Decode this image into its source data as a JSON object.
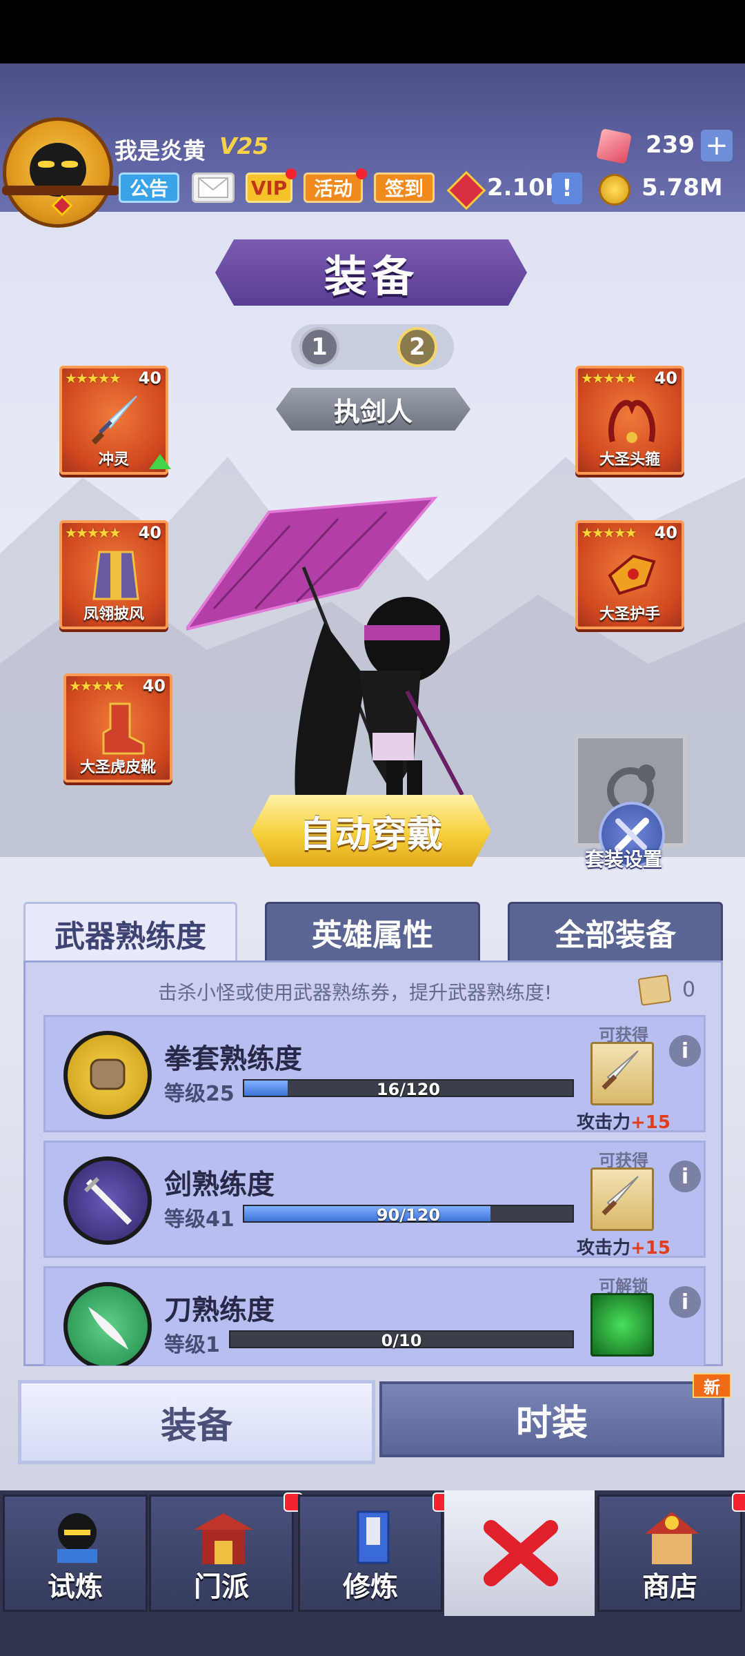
{
  "player": {
    "name": "我是炎黄",
    "vip_level": "V25"
  },
  "top_buttons": {
    "notice": "公告",
    "vip": "VIP",
    "activity": "活动",
    "signin": "签到"
  },
  "resources": {
    "gems": "239",
    "honor": "2.10K",
    "coins": "5.78M"
  },
  "screen_title": "装备",
  "page_switch": {
    "page1": "1",
    "page2": "2",
    "selected": "2"
  },
  "class_name": "执剑人",
  "equipment": [
    {
      "name": "冲灵",
      "level": "40",
      "stars": "★★★★★",
      "upgrade": true
    },
    {
      "name": "凤翎披风",
      "level": "40",
      "stars": "★★★★★"
    },
    {
      "name": "大圣虎皮靴",
      "level": "40",
      "stars": "★★★★★"
    },
    {
      "name": "大圣头箍",
      "level": "40",
      "stars": "★★★★★"
    },
    {
      "name": "大圣护手",
      "level": "40",
      "stars": "★★★★★"
    }
  ],
  "auto_equip": "自动穿戴",
  "set_settings": "套装设置",
  "tabs": [
    "武器熟练度",
    "英雄属性",
    "全部装备"
  ],
  "proficiency": {
    "hint": "击杀小怪或使用武器熟练券，提升武器熟练度!",
    "ticket_count": "0",
    "rows": [
      {
        "name": "拳套熟练度",
        "level_text": "等级25",
        "progress_text": "16/120",
        "progress": 0.133,
        "status": "可获得",
        "reward_label": "攻击力",
        "reward_value": "+15"
      },
      {
        "name": "剑熟练度",
        "level_text": "等级41",
        "progress_text": "90/120",
        "progress": 0.75,
        "status": "可获得",
        "reward_label": "攻击力",
        "reward_value": "+15"
      },
      {
        "name": "刀熟练度",
        "level_text": "等级1",
        "progress_text": "0/10",
        "progress": 0,
        "status": "可解锁"
      }
    ]
  },
  "sub_tabs": {
    "equipment": "装备",
    "fashion": "时装",
    "new_badge": "新"
  },
  "bottom_nav": [
    "试炼",
    "门派",
    "修炼",
    "商店"
  ],
  "colors": {
    "accent_purple": "#5a3d94",
    "gold": "#f6cf3a",
    "reward_red": "#e23c19"
  }
}
